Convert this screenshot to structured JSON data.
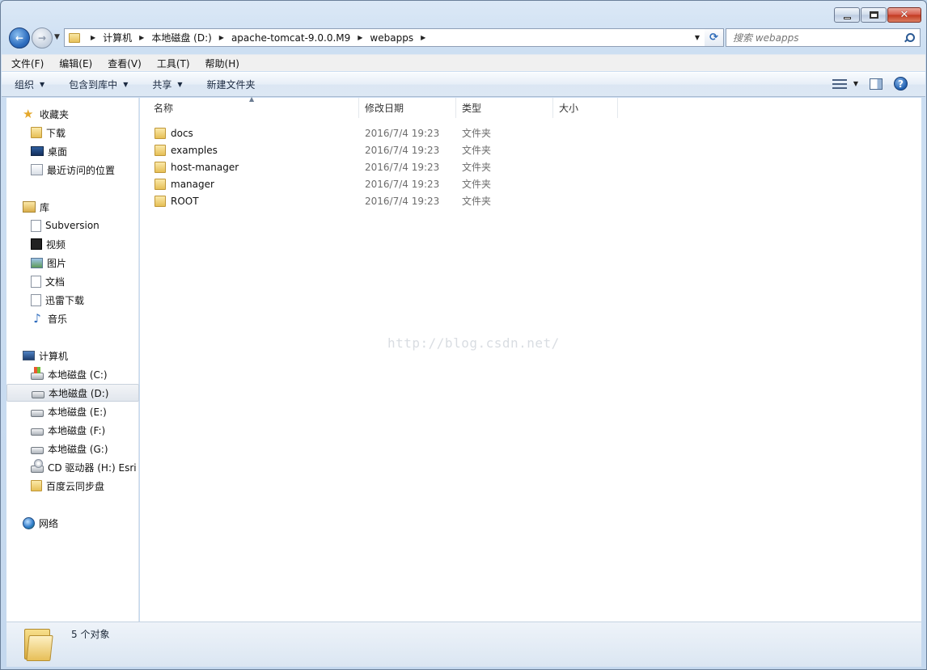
{
  "window": {
    "caption_buttons": {
      "minimize": "minimize",
      "maximize": "maximize",
      "close": "✕"
    }
  },
  "address": {
    "crumbs": [
      "计算机",
      "本地磁盘 (D:)",
      "apache-tomcat-9.0.0.M9",
      "webapps"
    ]
  },
  "search": {
    "placeholder": "搜索 webapps"
  },
  "menu": [
    "文件(F)",
    "编辑(E)",
    "查看(V)",
    "工具(T)",
    "帮助(H)"
  ],
  "commands": {
    "organize": "组织",
    "include_in_library": "包含到库中",
    "share": "共享",
    "new_folder": "新建文件夹"
  },
  "navpane": {
    "favorites": {
      "label": "收藏夹",
      "items": [
        "下载",
        "桌面",
        "最近访问的位置"
      ]
    },
    "libraries": {
      "label": "库",
      "items": [
        "Subversion",
        "视频",
        "图片",
        "文档",
        "迅雷下载",
        "音乐"
      ]
    },
    "computer": {
      "label": "计算机",
      "items": [
        "本地磁盘 (C:)",
        "本地磁盘 (D:)",
        "本地磁盘 (E:)",
        "本地磁盘 (F:)",
        "本地磁盘 (G:)",
        "CD 驱动器 (H:) Esri",
        "百度云同步盘"
      ],
      "selected_index": 1
    },
    "network": {
      "label": "网络"
    }
  },
  "columns": [
    "名称",
    "修改日期",
    "类型",
    "大小"
  ],
  "files": [
    {
      "name": "docs",
      "date": "2016/7/4 19:23",
      "type": "文件夹"
    },
    {
      "name": "examples",
      "date": "2016/7/4 19:23",
      "type": "文件夹"
    },
    {
      "name": "host-manager",
      "date": "2016/7/4 19:23",
      "type": "文件夹"
    },
    {
      "name": "manager",
      "date": "2016/7/4 19:23",
      "type": "文件夹"
    },
    {
      "name": "ROOT",
      "date": "2016/7/4 19:23",
      "type": "文件夹"
    }
  ],
  "watermark": "http://blog.csdn.net/",
  "status": {
    "count_text": "5 个对象"
  },
  "colors": {
    "selection": "#e1e6ed",
    "accent": "#2f6fc0"
  }
}
